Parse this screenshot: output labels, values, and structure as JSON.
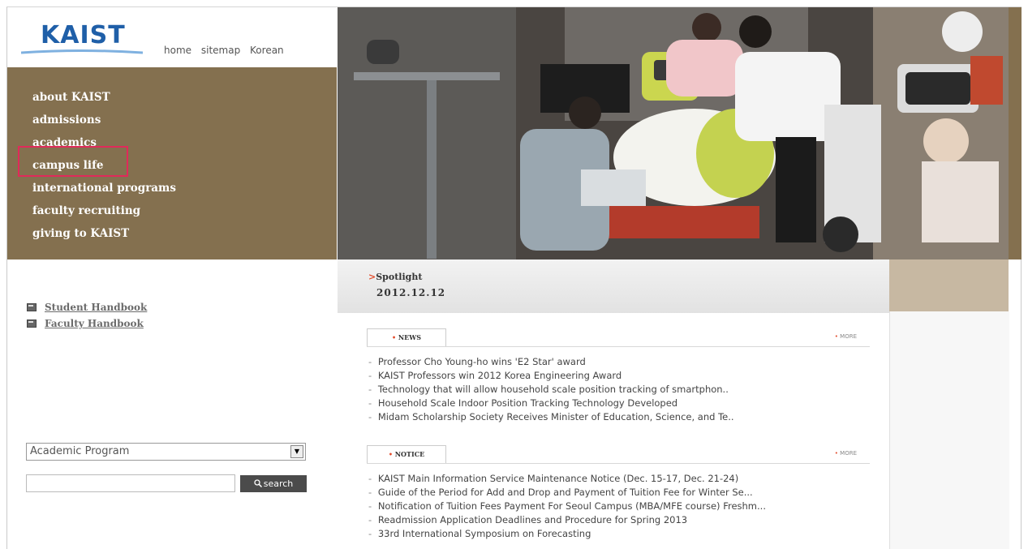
{
  "logo": {
    "text": "KAIST"
  },
  "top_links": [
    "home",
    "sitemap",
    "Korean"
  ],
  "menu": {
    "items": [
      "about KAIST",
      "admissions",
      "academics",
      "campus life",
      "international programs",
      "faculty recruiting",
      "giving to KAIST"
    ],
    "highlighted": "campus life"
  },
  "hero": {
    "description_icon": "robotics-lab-photo"
  },
  "handbooks": [
    "Student Handbook",
    "Faculty Handbook"
  ],
  "search": {
    "category_selected": "Academic Program",
    "input_value": "",
    "button_label": "search"
  },
  "spotlight": {
    "title": "Spotlight",
    "date": "2012.12.12"
  },
  "news": {
    "tab_label": "NEWS",
    "more_label": "MORE",
    "items": [
      "Professor Cho Young-ho wins 'E2 Star' award",
      "KAIST Professors win 2012 Korea Engineering Award",
      "Technology that will allow household scale position tracking of smartphon..",
      "Household Scale Indoor Position Tracking Technology Developed",
      "Midam Scholarship Society Receives Minister of Education, Science, and Te.."
    ]
  },
  "notice": {
    "tab_label": "NOTICE",
    "more_label": "MORE",
    "items": [
      "KAIST Main Information Service Maintenance Notice (Dec. 15-17, Dec. 21-24)",
      "Guide of the Period for Add and Drop and Payment of Tuition Fee for Winter Se...",
      "Notification of Tuition Fees Payment For Seoul Campus (MBA/MFE course) Freshm...",
      "Readmission Application Deadlines and Procedure for Spring 2013",
      "33rd International Symposium on Forecasting"
    ]
  },
  "colors": {
    "brand_blue": "#1f5fa8",
    "menu_bg": "#84704f",
    "highlight": "#e02a5a",
    "accent_orange": "#e34b2a"
  }
}
